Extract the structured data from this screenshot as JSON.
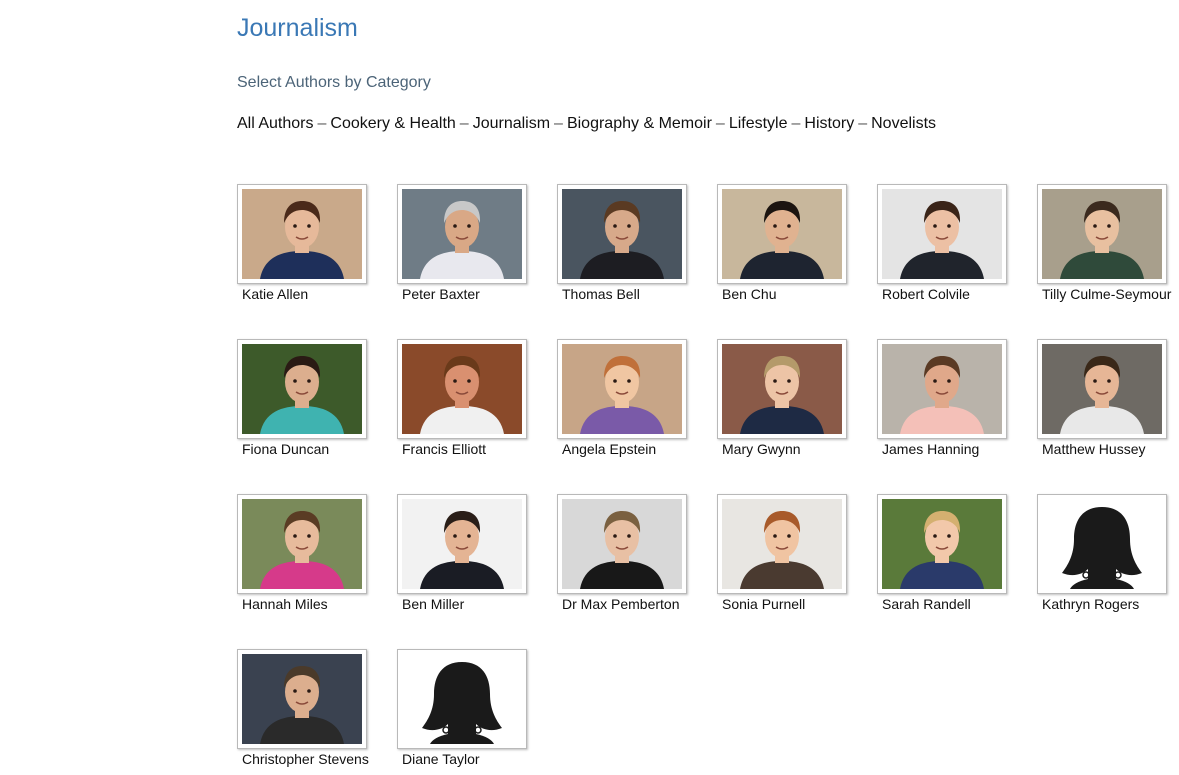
{
  "page": {
    "title": "Journalism",
    "category_heading": "Select Authors by Category"
  },
  "categories": [
    {
      "label": "All Authors"
    },
    {
      "label": "Cookery & Health"
    },
    {
      "label": "Journalism"
    },
    {
      "label": "Biography & Memoir"
    },
    {
      "label": "Lifestyle"
    },
    {
      "label": "History"
    },
    {
      "label": "Novelists"
    }
  ],
  "separator": "–",
  "authors": [
    {
      "name": "Katie Allen",
      "photo": "portrait-photo",
      "bg": "#c9a98a",
      "hair": "#4a2a1a",
      "skin": "#e6b99a",
      "shirt": "#1e2f5a"
    },
    {
      "name": "Peter Baxter",
      "photo": "portrait-photo",
      "bg": "#6f7c86",
      "hair": "#c8c8c8",
      "skin": "#d9a886",
      "shirt": "#e8e8ee"
    },
    {
      "name": "Thomas Bell",
      "photo": "portrait-photo",
      "bg": "#4a5560",
      "hair": "#5a3a22",
      "skin": "#d7a98a",
      "shirt": "#1d1d22"
    },
    {
      "name": "Ben Chu",
      "photo": "portrait-photo",
      "bg": "#c8b79c",
      "hair": "#1c1410",
      "skin": "#e0b290",
      "shirt": "#1e2430"
    },
    {
      "name": "Robert Colvile",
      "photo": "portrait-photo",
      "bg": "#e4e4e4",
      "hair": "#3a2418",
      "skin": "#ecc0a4",
      "shirt": "#20242c"
    },
    {
      "name": "Tilly Culme-Seymour",
      "photo": "portrait-photo",
      "bg": "#a89f8c",
      "hair": "#3b2a1e",
      "skin": "#e8c0a0",
      "shirt": "#2f4a3a"
    },
    {
      "name": "Fiona Duncan",
      "photo": "portrait-photo",
      "bg": "#3d5a2a",
      "hair": "#2a1a14",
      "skin": "#dcae8e",
      "shirt": "#3fb3b0"
    },
    {
      "name": "Francis Elliott",
      "photo": "portrait-photo",
      "bg": "#8a4a2a",
      "hair": "#6a3a1a",
      "skin": "#d99070",
      "shirt": "#f0f0f0"
    },
    {
      "name": "Angela Epstein",
      "photo": "portrait-photo",
      "bg": "#c7a587",
      "hair": "#c0703a",
      "skin": "#f0c6a2",
      "shirt": "#7a5aa8"
    },
    {
      "name": "Mary Gwynn",
      "photo": "portrait-photo",
      "bg": "#8a5a48",
      "hair": "#b49a6a",
      "skin": "#edc4a6",
      "shirt": "#1e2a44"
    },
    {
      "name": "James Hanning",
      "photo": "portrait-photo",
      "bg": "#b9b3aa",
      "hair": "#5a3a24",
      "skin": "#e0a88a",
      "shirt": "#f4c0b8"
    },
    {
      "name": "Matthew Hussey",
      "photo": "portrait-photo",
      "bg": "#6e6a64",
      "hair": "#3a2818",
      "skin": "#e6b696",
      "shirt": "#e8e8e8"
    },
    {
      "name": "Hannah Miles",
      "photo": "portrait-photo",
      "bg": "#7a8a5a",
      "hair": "#5a3c24",
      "skin": "#e7bb9c",
      "shirt": "#d63a8a"
    },
    {
      "name": "Ben Miller",
      "photo": "portrait-photo",
      "bg": "#f2f2f2",
      "hair": "#2a1e18",
      "skin": "#e4b494",
      "shirt": "#1a1c24"
    },
    {
      "name": "Dr Max Pemberton",
      "photo": "portrait-photo",
      "bg": "#d8d8d8",
      "hair": "#7a6040",
      "skin": "#e8c0a4",
      "shirt": "#181818"
    },
    {
      "name": "Sonia Purnell",
      "photo": "portrait-photo",
      "bg": "#e8e6e2",
      "hair": "#a85a2a",
      "skin": "#f0c4a2",
      "shirt": "#4a3a30"
    },
    {
      "name": "Sarah Randell",
      "photo": "portrait-photo",
      "bg": "#5a7a3a",
      "hair": "#d4b070",
      "skin": "#f2c8aa",
      "shirt": "#2a3a6a"
    },
    {
      "name": "Kathryn Rogers",
      "photo": "silhouette",
      "bg": "#ffffff",
      "hair": "#111111",
      "skin": "#111111",
      "shirt": "#111111"
    },
    {
      "name": "Christopher Stevens",
      "photo": "portrait-photo",
      "bg": "#3a4250",
      "hair": "#4a3a2a",
      "skin": "#dcae8e",
      "shirt": "#2a2a2a"
    },
    {
      "name": "Diane Taylor",
      "photo": "silhouette",
      "bg": "#ffffff",
      "hair": "#111111",
      "skin": "#111111",
      "shirt": "#111111"
    }
  ]
}
